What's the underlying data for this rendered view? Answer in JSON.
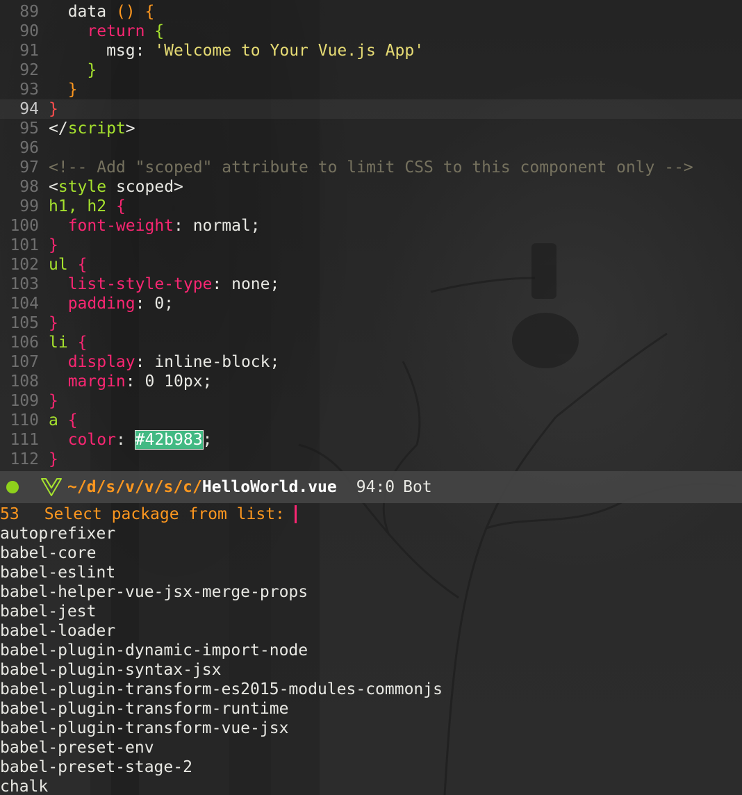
{
  "editor": {
    "lines": [
      {
        "n": "89",
        "tokens": [
          [
            "t-plain",
            "  data "
          ],
          [
            "t-orange",
            "()"
          ],
          [
            "t-plain",
            " "
          ],
          [
            "t-orange",
            "{"
          ]
        ]
      },
      {
        "n": "90",
        "tokens": [
          [
            "t-pink",
            "    return "
          ],
          [
            "t-green",
            "{"
          ]
        ]
      },
      {
        "n": "91",
        "tokens": [
          [
            "t-plain",
            "      msg: "
          ],
          [
            "t-yellow",
            "'Welcome to Your Vue.js App'"
          ]
        ]
      },
      {
        "n": "92",
        "tokens": [
          [
            "t-green",
            "    }"
          ]
        ]
      },
      {
        "n": "93",
        "tokens": [
          [
            "t-orange",
            "  }"
          ]
        ]
      },
      {
        "n": "94",
        "current": true,
        "tokens": [
          [
            "t-red",
            "}"
          ]
        ]
      },
      {
        "n": "95",
        "tokens": [
          [
            "t-plain",
            "</"
          ],
          [
            "t-green",
            "script"
          ],
          [
            "t-plain",
            ">"
          ]
        ]
      },
      {
        "n": "96",
        "tokens": []
      },
      {
        "n": "97",
        "tokens": [
          [
            "t-comment",
            "<!-- Add \"scoped\" attribute to limit CSS to this component only -->"
          ]
        ]
      },
      {
        "n": "98",
        "tokens": [
          [
            "t-plain",
            "<"
          ],
          [
            "t-green",
            "style"
          ],
          [
            "t-plain",
            " scoped>"
          ]
        ]
      },
      {
        "n": "99",
        "tokens": [
          [
            "t-green",
            "h1, h2"
          ],
          [
            "t-plain",
            " "
          ],
          [
            "t-pink",
            "{"
          ]
        ]
      },
      {
        "n": "100",
        "tokens": [
          [
            "t-pink",
            "  font-weight"
          ],
          [
            "t-plain",
            ": normal;"
          ]
        ]
      },
      {
        "n": "101",
        "tokens": [
          [
            "t-pink",
            "}"
          ]
        ]
      },
      {
        "n": "102",
        "tokens": [
          [
            "t-green",
            "ul"
          ],
          [
            "t-plain",
            " "
          ],
          [
            "t-pink",
            "{"
          ]
        ]
      },
      {
        "n": "103",
        "tokens": [
          [
            "t-pink",
            "  list-style-type"
          ],
          [
            "t-plain",
            ": none;"
          ]
        ]
      },
      {
        "n": "104",
        "tokens": [
          [
            "t-pink",
            "  padding"
          ],
          [
            "t-plain",
            ": 0;"
          ]
        ]
      },
      {
        "n": "105",
        "tokens": [
          [
            "t-pink",
            "}"
          ]
        ]
      },
      {
        "n": "106",
        "tokens": [
          [
            "t-green",
            "li"
          ],
          [
            "t-plain",
            " "
          ],
          [
            "t-pink",
            "{"
          ]
        ]
      },
      {
        "n": "107",
        "tokens": [
          [
            "t-pink",
            "  display"
          ],
          [
            "t-plain",
            ": inline-block;"
          ]
        ]
      },
      {
        "n": "108",
        "tokens": [
          [
            "t-pink",
            "  margin"
          ],
          [
            "t-plain",
            ": 0 10px;"
          ]
        ]
      },
      {
        "n": "109",
        "tokens": [
          [
            "t-pink",
            "}"
          ]
        ]
      },
      {
        "n": "110",
        "tokens": [
          [
            "t-green",
            "a"
          ],
          [
            "t-plain",
            " "
          ],
          [
            "t-pink",
            "{"
          ]
        ]
      },
      {
        "n": "111",
        "tokens": [
          [
            "t-pink",
            "  color"
          ],
          [
            "t-plain",
            ": "
          ],
          [
            "hexsw",
            "#42b983"
          ],
          [
            "t-plain",
            ";"
          ]
        ]
      },
      {
        "n": "112",
        "tokens": [
          [
            "t-pink",
            "}"
          ]
        ]
      }
    ]
  },
  "modeline": {
    "path": "~/d/s/v/v/s/c/",
    "filename": "HelloWorld.vue",
    "position": "94:0",
    "scroll_state": "Bot",
    "status_color": "#8ed11c"
  },
  "minibuffer": {
    "count": "53",
    "prompt": "Select package from list:",
    "candidates": [
      "autoprefixer",
      "babel-core",
      "babel-eslint",
      "babel-helper-vue-jsx-merge-props",
      "babel-jest",
      "babel-loader",
      "babel-plugin-dynamic-import-node",
      "babel-plugin-syntax-jsx",
      "babel-plugin-transform-es2015-modules-commonjs",
      "babel-plugin-transform-runtime",
      "babel-plugin-transform-vue-jsx",
      "babel-preset-env",
      "babel-preset-stage-2",
      "chalk"
    ]
  },
  "colors": {
    "accent_orange": "#fd971f",
    "keyword_pink": "#f92672",
    "tag_green": "#a6e22e",
    "string_yellow": "#e6db74",
    "vue_green": "#42b983"
  }
}
